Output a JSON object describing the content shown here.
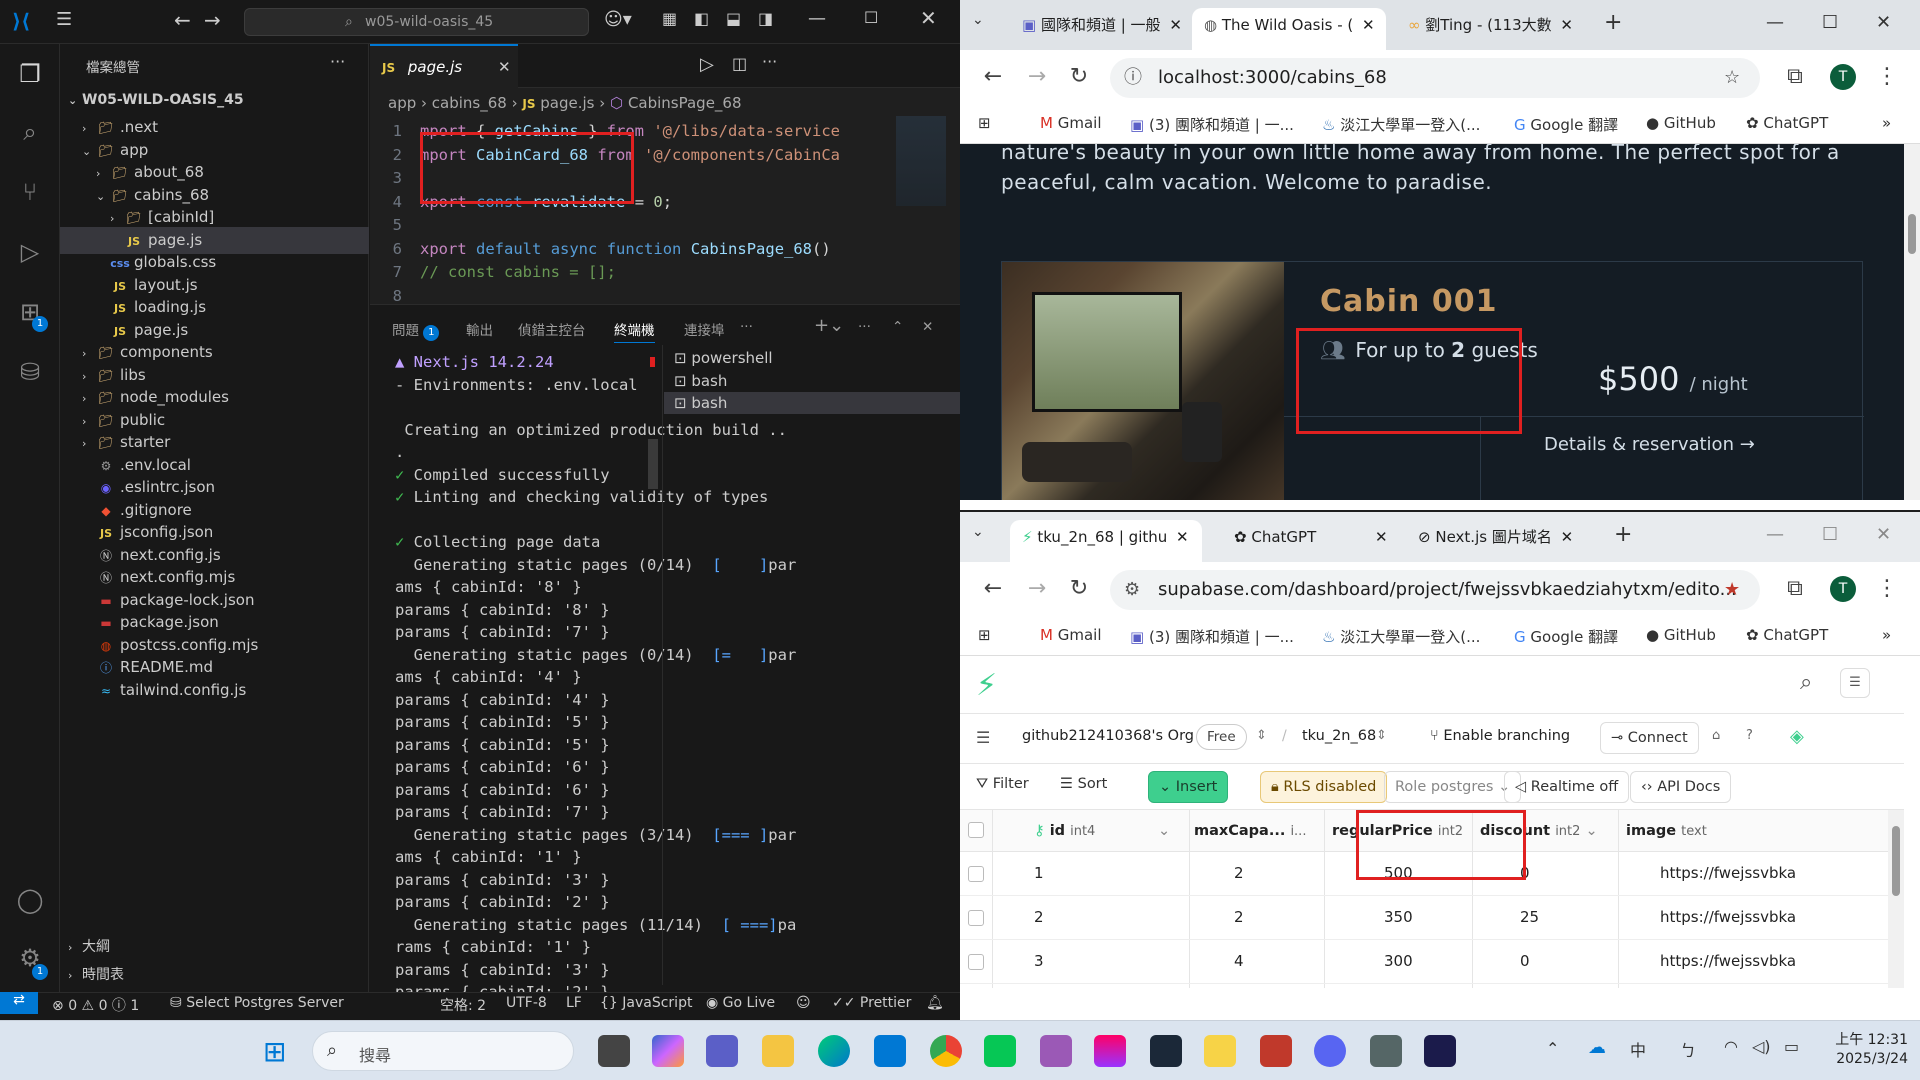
{
  "vscode": {
    "search_text": "w05-wild-oasis_45",
    "explorer_title": "檔案總管",
    "root_folder": "W05-WILD-OASIS_45",
    "tree": [
      {
        "label": ".next",
        "type": "folder",
        "depth": 1,
        "open": false
      },
      {
        "label": "app",
        "type": "folder",
        "depth": 1,
        "open": true
      },
      {
        "label": "about_68",
        "type": "folder",
        "depth": 2,
        "open": false
      },
      {
        "label": "cabins_68",
        "type": "folder",
        "depth": 2,
        "open": true
      },
      {
        "label": "[cabinId]",
        "type": "folder",
        "depth": 3,
        "open": false
      },
      {
        "label": "page.js",
        "type": "js",
        "depth": 3,
        "selected": true
      },
      {
        "label": "globals.css",
        "type": "css",
        "depth": 2
      },
      {
        "label": "layout.js",
        "type": "js",
        "depth": 2
      },
      {
        "label": "loading.js",
        "type": "js",
        "depth": 2
      },
      {
        "label": "page.js",
        "type": "js",
        "depth": 2
      },
      {
        "label": "components",
        "type": "folder",
        "depth": 1,
        "open": false
      },
      {
        "label": "libs",
        "type": "folder",
        "depth": 1,
        "open": false
      },
      {
        "label": "node_modules",
        "type": "folder",
        "depth": 1,
        "open": false
      },
      {
        "label": "public",
        "type": "folder",
        "depth": 1,
        "open": false
      },
      {
        "label": "starter",
        "type": "folder",
        "depth": 1,
        "open": false
      },
      {
        "label": ".env.local",
        "type": "env",
        "depth": 1
      },
      {
        "label": ".eslintrc.json",
        "type": "eslint",
        "depth": 1
      },
      {
        "label": ".gitignore",
        "type": "git",
        "depth": 1
      },
      {
        "label": "jsconfig.json",
        "type": "js",
        "depth": 1
      },
      {
        "label": "next.config.js",
        "type": "next",
        "depth": 1
      },
      {
        "label": "next.config.mjs",
        "type": "next",
        "depth": 1
      },
      {
        "label": "package-lock.json",
        "type": "npm",
        "depth": 1
      },
      {
        "label": "package.json",
        "type": "npm",
        "depth": 1
      },
      {
        "label": "postcss.config.mjs",
        "type": "postcss",
        "depth": 1
      },
      {
        "label": "README.md",
        "type": "md",
        "depth": 1
      },
      {
        "label": "tailwind.config.js",
        "type": "tw",
        "depth": 1
      }
    ],
    "outline_label": "大綱",
    "timeline_label": "時間表",
    "tab_label": "page.js",
    "breadcrumb": [
      "app",
      "cabins_68",
      "page.js",
      "CabinsPage_68"
    ],
    "code_lines": [
      {
        "n": "1",
        "text": "mport { getCabins } from '@/libs/data-service"
      },
      {
        "n": "2",
        "text": "mport CabinCard_68 from '@/components/CabinCa"
      },
      {
        "n": "3",
        "text": ""
      },
      {
        "n": "4",
        "text": "xport const revalidate = 0;"
      },
      {
        "n": "5",
        "text": ""
      },
      {
        "n": "6",
        "text": "xport default async function CabinsPage_68()"
      },
      {
        "n": "7",
        "text": "// const cabins = [];"
      },
      {
        "n": "8",
        "text": ""
      }
    ],
    "panel_tabs": [
      "問題",
      "輸出",
      "偵錯主控台",
      "終端機",
      "連接埠"
    ],
    "problems_count": "1",
    "terminal_lines": [
      "▲ Next.js 14.2.24",
      "- Environments: .env.local",
      "",
      " Creating an optimized production build ..",
      ".",
      "✓ Compiled successfully",
      "✓ Linting and checking validity of types",
      "",
      "✓ Collecting page data",
      "  Generating static pages (0/14)  [    ]par",
      "ams { cabinId: '8' }",
      "params { cabinId: '8' }",
      "params { cabinId: '7' }",
      "  Generating static pages (0/14)  [=   ]par",
      "ams { cabinId: '4' }",
      "params { cabinId: '4' }",
      "params { cabinId: '5' }",
      "params { cabinId: '5' }",
      "params { cabinId: '6' }",
      "params { cabinId: '6' }",
      "params { cabinId: '7' }",
      "  Generating static pages (3/14)  [=== ]par",
      "ams { cabinId: '1' }",
      "params { cabinId: '3' }",
      "params { cabinId: '2' }",
      "  Generating static pages (11/14)  [ ===]pa",
      "rams { cabinId: '1' }",
      "params { cabinId: '3' }",
      "params { cabinId: '2' }"
    ],
    "terminals": [
      "powershell",
      "bash",
      "bash"
    ],
    "status": {
      "errors": "0",
      "warnings": "0",
      "info": "1",
      "postgres": "Select Postgres Server",
      "spaces": "空格: 2",
      "encoding": "UTF-8",
      "eol": "LF",
      "language": "JavaScript",
      "golive": "Go Live",
      "prettier": "Prettier"
    }
  },
  "browser_top": {
    "tabs": [
      "國隊和頻道 | 一般",
      "The Wild Oasis - (",
      "劉Ting - (113大數"
    ],
    "url": "localhost:3000/cabins_68",
    "bookmarks": [
      "Gmail",
      "(3) 團隊和頻道 | 一...",
      "淡江大學單一登入(...",
      "Google 翻譯",
      "GitHub",
      "ChatGPT"
    ],
    "profile": "T",
    "intro_line1": "nature's beauty in your own little home away from home. The perfect spot for a",
    "intro_line2": "peaceful, calm vacation. Welcome to paradise.",
    "cabin_name": "Cabin 001",
    "guests_text_pre": "For up to ",
    "guests_num": "2",
    "guests_text_post": " guests",
    "price": "$500",
    "per_night": "/ night",
    "details_link": "Details & reservation →"
  },
  "browser_bottom": {
    "tabs": [
      "tku_2n_68 | githu",
      "ChatGPT",
      "Next.js 圖片域名"
    ],
    "url": "supabase.com/dashboard/project/fwejssvbkaedziahytxm/edito...",
    "bookmarks": [
      "Gmail",
      "(3) 團隊和頻道 | 一...",
      "淡江大學單一登入(...",
      "Google 翻譯",
      "GitHub",
      "ChatGPT"
    ],
    "profile": "T",
    "org": "github212410368's Org",
    "plan": "Free",
    "project": "tku_2n_68",
    "enable_branching": "Enable branching",
    "connect": "Connect",
    "toolbar": {
      "filter": "Filter",
      "sort": "Sort",
      "insert": "Insert",
      "rls": "RLS disabled",
      "role": "Role postgres",
      "realtime": "Realtime off",
      "api": "API Docs"
    },
    "columns": [
      {
        "name": "id",
        "type": "int4"
      },
      {
        "name": "maxCapa...",
        "type": "i..."
      },
      {
        "name": "regularPrice",
        "type": "int2"
      },
      {
        "name": "discount",
        "type": "int2"
      },
      {
        "name": "image",
        "type": "text"
      }
    ],
    "rows": [
      {
        "id": "1",
        "max": "2",
        "price": "500",
        "discount": "0",
        "image": "https://fwejssvbka"
      },
      {
        "id": "2",
        "max": "2",
        "price": "350",
        "discount": "25",
        "image": "https://fwejssvbka"
      },
      {
        "id": "3",
        "max": "4",
        "price": "300",
        "discount": "0",
        "image": "https://fwejssvbka"
      }
    ]
  },
  "taskbar": {
    "search_placeholder": "搜尋",
    "ime": "中",
    "time": "上午 12:31",
    "date": "2025/3/24"
  },
  "colors": {
    "accent": "#0078d4",
    "supabase_green": "#3ecf8e",
    "oasis_gold": "#c69963",
    "highlight_red": "#e02020"
  }
}
